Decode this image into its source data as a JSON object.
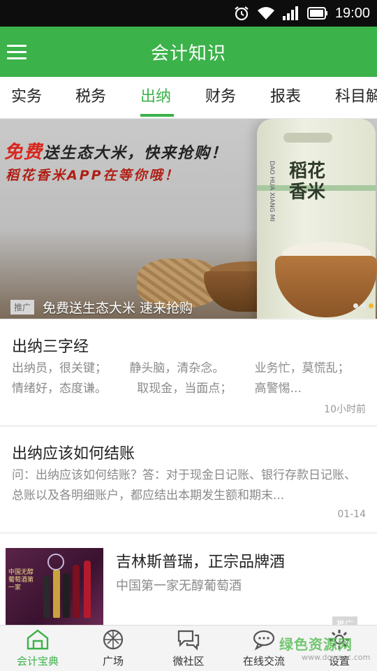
{
  "status_bar": {
    "time": "19:00"
  },
  "app_bar": {
    "title": "会计知识"
  },
  "tabs": [
    {
      "label": "实务",
      "active": false
    },
    {
      "label": "税务",
      "active": false
    },
    {
      "label": "出纳",
      "active": true
    },
    {
      "label": "财务",
      "active": false
    },
    {
      "label": "报表",
      "active": false
    },
    {
      "label": "科目解",
      "active": false
    }
  ],
  "banner": {
    "headline_red": "免费",
    "headline_rest": "送生态大米，快来抢购！",
    "headline2": "稻花香米APP在等你哦！",
    "bag_text": "稻花香米",
    "bag_small_text": "DAO HUA XIANG MI",
    "tag": "推广",
    "caption": "免费送生态大米 速来抢购",
    "slides": 3,
    "active_slide": 3
  },
  "articles": [
    {
      "title": "出纳三字经",
      "summary": "出纳员，很关键；      静头脑，清杂念。        业务忙，莫慌乱；      情绪好，态度谦。        取现金，当面点；      高警惕...",
      "time": "10小时前"
    },
    {
      "title": "出纳应该如何结账",
      "summary": "问：出纳应该如何结账？答：对于现金日记账、银行存款日记账、总账以及各明细账户，都应结出本期发生额和期末...",
      "time": "01-14"
    }
  ],
  "ad": {
    "title": "吉林斯普瑞，正宗品牌酒",
    "description": "中国第一家无醇葡萄酒",
    "tag": "推广",
    "image_text": "中国无醇葡萄酒第一家"
  },
  "bottom_nav": [
    {
      "label": "会计宝典",
      "icon": "book-icon",
      "active": true
    },
    {
      "label": "广场",
      "icon": "aperture-icon",
      "active": false
    },
    {
      "label": "微社区",
      "icon": "chat-bubbles-icon",
      "active": false
    },
    {
      "label": "在线交流",
      "icon": "online-chat-icon",
      "active": false
    },
    {
      "label": "设置",
      "icon": "gear-icon",
      "active": false
    }
  ],
  "watermark": {
    "text": "绿色资源网",
    "url": "www.downcc.com"
  },
  "colors": {
    "accent": "#3cb24a",
    "status_bar": "#0d0d0d",
    "indicator_active": "#f0b833"
  }
}
